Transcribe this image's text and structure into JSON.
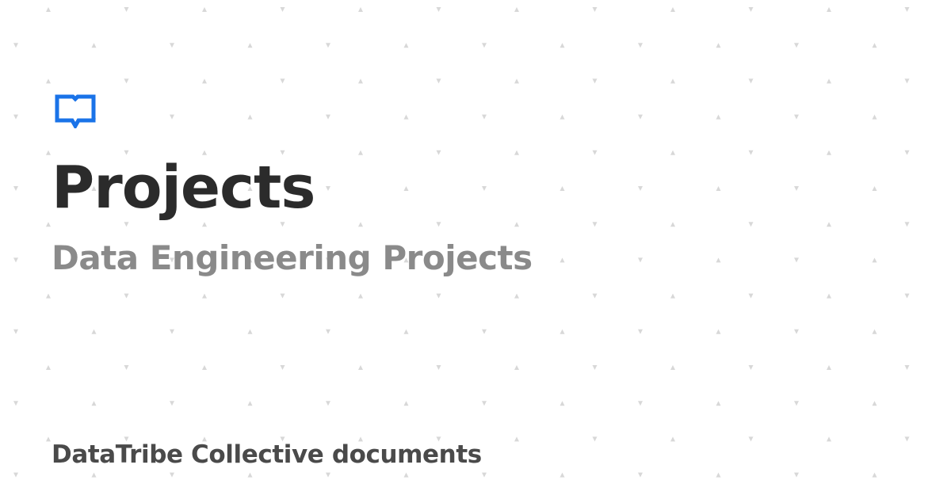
{
  "card": {
    "logo_icon": "book-bubble-icon",
    "title": "Projects",
    "subtitle": "Data Engineering Projects",
    "footer": "DataTribe Collective documents"
  },
  "colors": {
    "accent": "#1a73e8",
    "title": "#2b2b2b",
    "subtitle": "#8a8a8a",
    "footer": "#4a4a4a",
    "pattern": "#d8d8d8",
    "background": "#ffffff"
  }
}
